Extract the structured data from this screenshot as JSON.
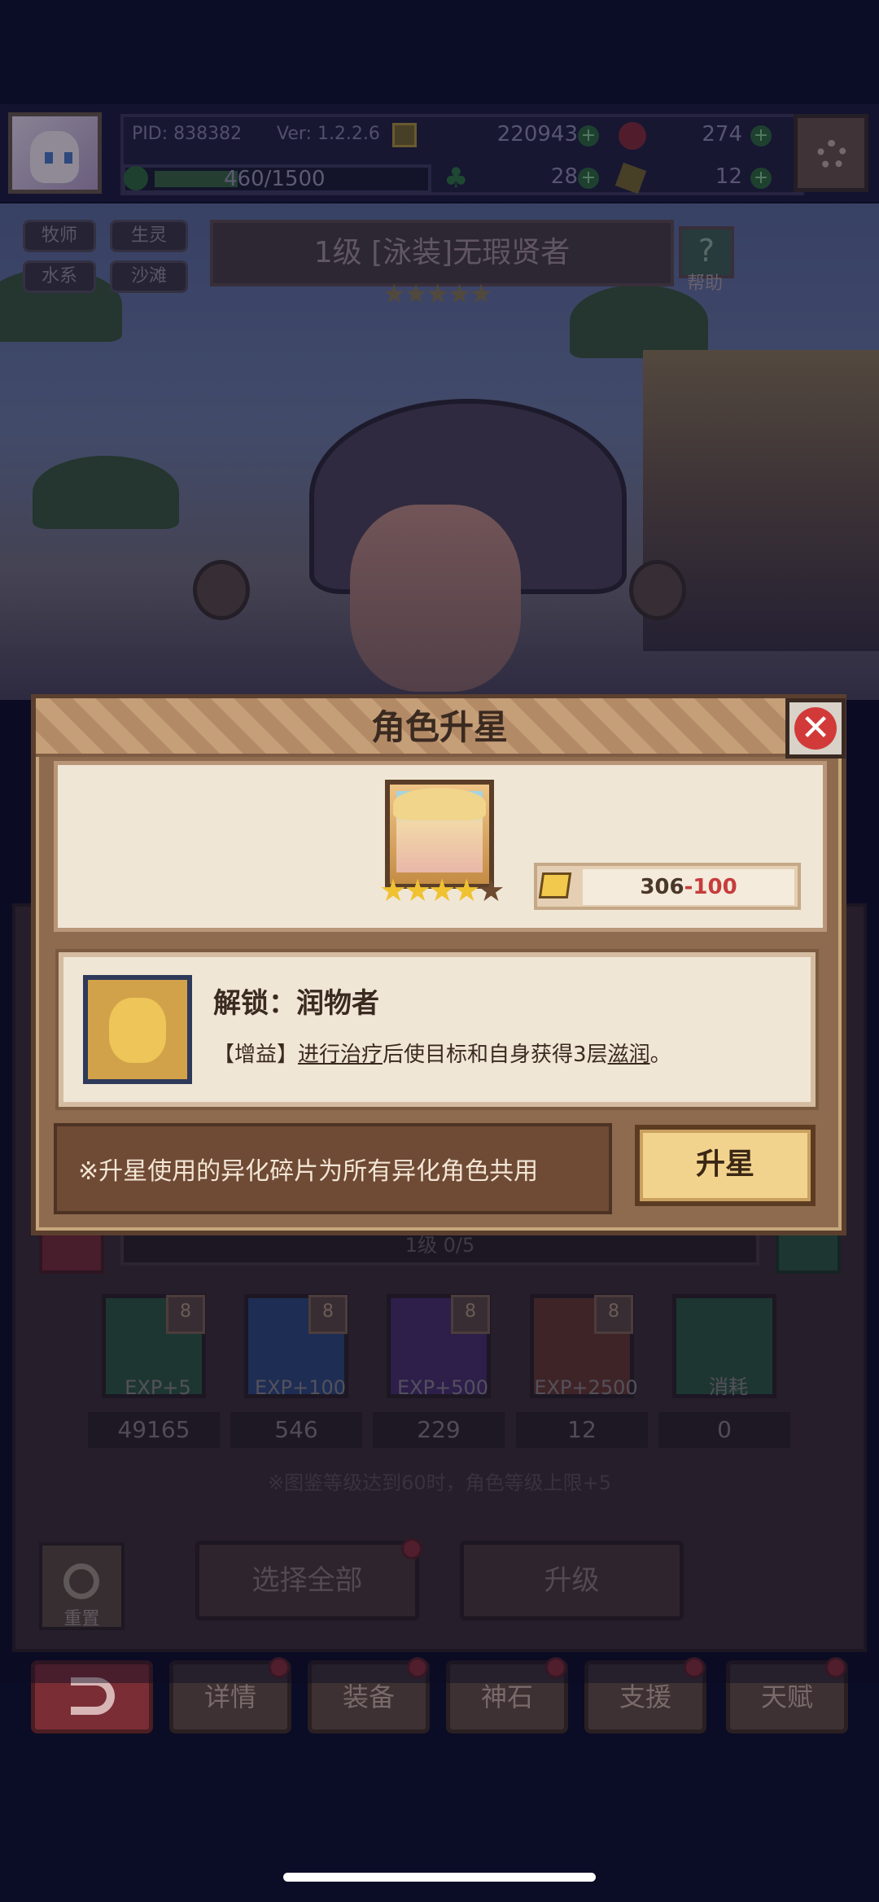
{
  "player": {
    "pid": "PID: 838382",
    "version": "Ver: 1.2.2.6",
    "exp": "460/1500",
    "exp_fraction": 0.31
  },
  "currencies": {
    "gold": "220943",
    "gem": "274",
    "clover": "28",
    "key": "12"
  },
  "tags": [
    "牧师",
    "生灵",
    "水系",
    "沙滩"
  ],
  "character": {
    "title": "1级 [泳装]无瑕贤者",
    "stars_total": 5,
    "stars_filled": 3,
    "help_label": "帮助"
  },
  "modal": {
    "title": "角色升星",
    "shard_have": "306",
    "shard_cost": "-100",
    "stars_filled": 4,
    "stars_total": 5,
    "unlock_title": "解锁：润物者",
    "desc_prefix": "【增益】",
    "desc_link1": "进行治疗",
    "desc_mid": "后使目标和自身获得3层",
    "desc_link2": "滋润",
    "desc_end": "。",
    "note": "※升星使用的异化碎片为所有异化角色共用",
    "upgrade_button": "升星"
  },
  "level_bar": "1级 0/5",
  "items": [
    {
      "label": "EXP+5",
      "badge": "8",
      "count": "49165",
      "color": "#2f5a3c"
    },
    {
      "label": "EXP+100",
      "badge": "8",
      "count": "546",
      "color": "#2f4a7a"
    },
    {
      "label": "EXP+500",
      "badge": "8",
      "count": "229",
      "color": "#4a2f6a"
    },
    {
      "label": "EXP+2500",
      "badge": "8",
      "count": "12",
      "color": "#6a3a2a"
    },
    {
      "label": "消耗",
      "badge": "",
      "count": "0",
      "color": "#2f5a3c"
    }
  ],
  "level_note": "※图鉴等级达到60时，角色等级上限+5",
  "buttons": {
    "reset": "重置",
    "select_all": "选择全部",
    "level_up": "升级"
  },
  "nav": [
    "详情",
    "装备",
    "神石",
    "支援",
    "天赋"
  ]
}
